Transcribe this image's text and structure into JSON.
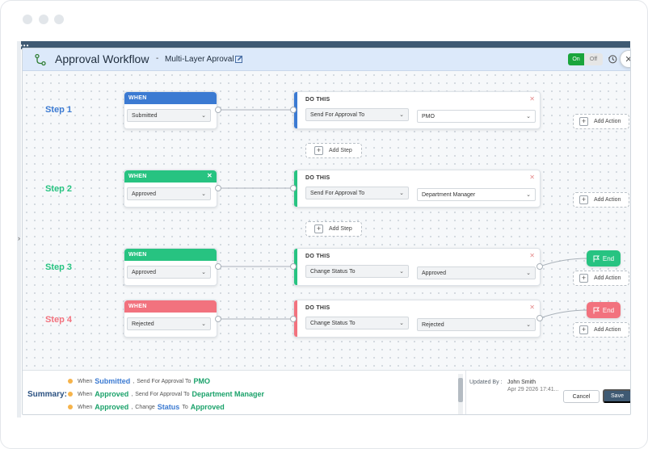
{
  "window": {
    "title": "Approval Workflow",
    "separator": "-",
    "subtitle": "Multi-Layer Aproval"
  },
  "toggle": {
    "on": "On",
    "off": "Off"
  },
  "icons": {
    "workflow": "workflow-icon",
    "edit": "edit-icon",
    "history": "history-icon",
    "close": "close-icon",
    "flag": "flag-icon",
    "plus": "plus-icon",
    "chevron": "chevron-down-icon"
  },
  "colors": {
    "blue": "#3b7ad2",
    "green": "#27c381",
    "red": "#f2727e",
    "navy": "#3f5a73"
  },
  "labels": {
    "when": "WHEN",
    "do_this": "DO THIS",
    "add_step": "Add Step",
    "add_action": "Add Action",
    "end": "End",
    "close_x": "✕",
    "chevron": "⌄",
    "plus": "+"
  },
  "steps": [
    {
      "label": "Step 1",
      "when_value": "Submitted",
      "action": "Send For Approval To",
      "target": "PMO"
    },
    {
      "label": "Step 2",
      "when_value": "Approved",
      "action": "Send For Approval To",
      "target": "Department Manager"
    },
    {
      "label": "Step 3",
      "when_value": "Approved",
      "action": "Change Status To",
      "target": "Approved"
    },
    {
      "label": "Step 4",
      "when_value": "Rejected",
      "action": "Change Status To",
      "target": "Rejected"
    }
  ],
  "summary": {
    "label": "Summary:",
    "lines": [
      {
        "when": "When",
        "value": "Submitted",
        "comma": ",",
        "action": "Send For Approval To",
        "target": "PMO"
      },
      {
        "when": "When",
        "value": "Approved",
        "comma": ",",
        "action": "Send For Approval To",
        "target": "Department Manager"
      },
      {
        "when": "When",
        "value": "Approved",
        "comma": ",",
        "action": "Change",
        "field": "Status",
        "to": "To",
        "target": "Approved"
      }
    ]
  },
  "footer": {
    "updated_by_label": "Updated By :",
    "updated_by": "John Smith",
    "updated_date": "Apr 29 2026 17:41...",
    "cancel": "Cancel",
    "save": "Save"
  }
}
